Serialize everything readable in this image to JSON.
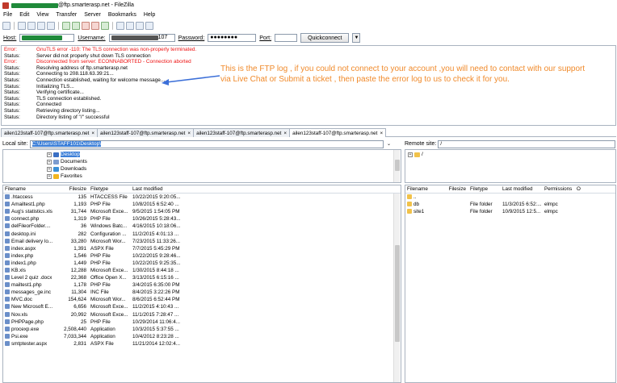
{
  "window": {
    "title_suffix": "@ftp.smarterasp.net - FileZilla"
  },
  "menu": [
    "File",
    "Edit",
    "View",
    "Transfer",
    "Server",
    "Bookmarks",
    "Help"
  ],
  "quickconnect": {
    "host_label": "Host:",
    "username_label": "Username:",
    "username_suffix": "107",
    "password_label": "Password:",
    "password_value": "●●●●●●●●",
    "port_label": "Port:",
    "port_value": "",
    "button": "Quickconnect",
    "dropdown": "▼"
  },
  "log": [
    {
      "type": "Error:",
      "msg": "GnuTLS error -110: The TLS connection was non-properly terminated.",
      "err": true
    },
    {
      "type": "Status:",
      "msg": "Server did not properly shut down TLS connection",
      "err": false
    },
    {
      "type": "Error:",
      "msg": "Disconnected from server: ECONNABORTED - Connection aborted",
      "err": true
    },
    {
      "type": "Status:",
      "msg": "Resolving address of ftp.smarterasp.net",
      "err": false
    },
    {
      "type": "Status:",
      "msg": "Connecting to 208.118.63.39:21...",
      "err": false
    },
    {
      "type": "Status:",
      "msg": "Connection established, waiting for welcome message...",
      "err": false
    },
    {
      "type": "Status:",
      "msg": "Initializing TLS...",
      "err": false
    },
    {
      "type": "Status:",
      "msg": "Verifying certificate...",
      "err": false
    },
    {
      "type": "Status:",
      "msg": "TLS connection established.",
      "err": false
    },
    {
      "type": "Status:",
      "msg": "Connected",
      "err": false
    },
    {
      "type": "Status:",
      "msg": "Retrieving directory listing...",
      "err": false
    },
    {
      "type": "Status:",
      "msg": "Directory listing of \"/\" successful",
      "err": false
    }
  ],
  "annotation": "This is the FTP log , if you could not connect to your account ,you will need to contact with our support via Live Chat or Submit a ticket , then paste the error log to us to check it for you.",
  "tabs": [
    {
      "label": "ailen123staff-107@ftp.smarterasp.net",
      "close": "×",
      "active": false
    },
    {
      "label": "ailen123staff-107@ftp.smarterasp.net",
      "close": "×",
      "active": false
    },
    {
      "label": "ailen123staff-107@ftp.smarterasp.net",
      "close": "×",
      "active": false
    },
    {
      "label": "ailen123staff-107@ftp.smarterasp.net",
      "close": "×",
      "active": true
    }
  ],
  "local": {
    "site_label": "Local site:",
    "site_path": "C:\\Users\\STAFF101\\Desktop\\",
    "tree": [
      {
        "label": "Desktop",
        "icon": "desktop-icon"
      },
      {
        "label": "Documents",
        "icon": "documents-icon"
      },
      {
        "label": "Downloads",
        "icon": "downloads-icon"
      },
      {
        "label": "Favorites",
        "icon": "favorites-icon"
      }
    ],
    "headers": [
      "Filename",
      "Filesize",
      "Filetype",
      "Last modified"
    ],
    "files": [
      {
        "name": ".htaccess",
        "size": "135",
        "type": "HTACCESS File",
        "modified": "10/22/2015 9:20:05..."
      },
      {
        "name": "Amailtest1.php",
        "size": "1,193",
        "type": "PHP File",
        "modified": "10/8/2015 6:52:40 ..."
      },
      {
        "name": "Aug's statistics.xls",
        "size": "31,744",
        "type": "Microsoft Exce...",
        "modified": "9/5/2015 1:54:05 PM"
      },
      {
        "name": "connect.php",
        "size": "1,319",
        "type": "PHP File",
        "modified": "10/26/2015 5:28:43..."
      },
      {
        "name": "delFileorFolder....",
        "size": "36",
        "type": "Windows Batc...",
        "modified": "4/16/2015 10:18:06..."
      },
      {
        "name": "desktop.ini",
        "size": "282",
        "type": "Configuration ...",
        "modified": "11/2/2015 4:01:13 ..."
      },
      {
        "name": "Email delivery lo...",
        "size": "33,280",
        "type": "Microsoft Wor...",
        "modified": "7/23/2015 11:33:26..."
      },
      {
        "name": "index.aspx",
        "size": "1,391",
        "type": "ASPX File",
        "modified": "7/7/2015 5:45:29 PM"
      },
      {
        "name": "index.php",
        "size": "1,546",
        "type": "PHP File",
        "modified": "10/22/2015 9:28:46..."
      },
      {
        "name": "index1.php",
        "size": "1,449",
        "type": "PHP File",
        "modified": "10/22/2015 9:25:35..."
      },
      {
        "name": "KB.xls",
        "size": "12,288",
        "type": "Microsoft Exce...",
        "modified": "1/30/2015 8:44:18 ..."
      },
      {
        "name": "Level 2 quiz .docx",
        "size": "22,368",
        "type": "Office Open X...",
        "modified": "3/13/2015 6:15:16 ..."
      },
      {
        "name": "mailtest1.php",
        "size": "1,178",
        "type": "PHP File",
        "modified": "3/4/2015 6:35:00 PM"
      },
      {
        "name": "messages_ge.inc",
        "size": "11,304",
        "type": "INC File",
        "modified": "8/4/2015 3:22:26 PM"
      },
      {
        "name": "MVC.doc",
        "size": "154,624",
        "type": "Microsoft Wor...",
        "modified": "8/6/2015 6:52:44 PM"
      },
      {
        "name": "New Microsoft E...",
        "size": "6,656",
        "type": "Microsoft Exce...",
        "modified": "11/2/2015 4:10:43 ..."
      },
      {
        "name": "Nov.xls",
        "size": "20,992",
        "type": "Microsoft Exce...",
        "modified": "11/1/2015 7:28:47 ..."
      },
      {
        "name": "PHPPage.php",
        "size": "25",
        "type": "PHP File",
        "modified": "10/29/2014 11:06:4..."
      },
      {
        "name": "procexp.exe",
        "size": "2,508,440",
        "type": "Application",
        "modified": "10/3/2015 5:37:55 ..."
      },
      {
        "name": "Psi.exe",
        "size": "7,033,344",
        "type": "Application",
        "modified": "10/4/2012 8:23:28 ..."
      },
      {
        "name": "smtptester.aspx",
        "size": "2,831",
        "type": "ASPX File",
        "modified": "11/21/2014 12:02:4..."
      }
    ]
  },
  "remote": {
    "site_label": "Remote site:",
    "site_path": "/",
    "tree_root": "/",
    "headers": [
      "Filename",
      "Filesize",
      "Filetype",
      "Last modified",
      "Permissions",
      "O"
    ],
    "files": [
      {
        "name": "..",
        "size": "",
        "type": "",
        "modified": "",
        "perms": ""
      },
      {
        "name": "db",
        "size": "",
        "type": "File folder",
        "modified": "11/3/2015 6:52:...",
        "perms": "elmpc"
      },
      {
        "name": "site1",
        "size": "",
        "type": "File folder",
        "modified": "10/9/2015 12:5...",
        "perms": "elmpc"
      }
    ]
  }
}
